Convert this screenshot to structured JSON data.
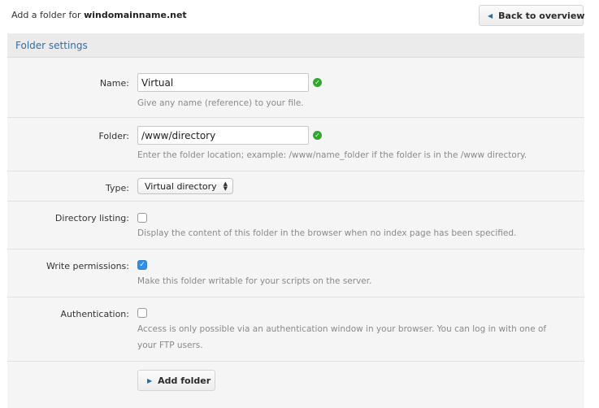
{
  "page": {
    "title_prefix": "Add a folder for",
    "domain": "windomainname.net",
    "back_label": "Back to overview"
  },
  "panel": {
    "title": "Folder settings"
  },
  "form": {
    "name": {
      "label": "Name:",
      "value": "Virtual",
      "help": "Give any name (reference) to your file."
    },
    "folder": {
      "label": "Folder:",
      "value": "/www/directory",
      "help": "Enter the folder location; example: /www/name_folder if the folder is in the /www directory."
    },
    "type": {
      "label": "Type:",
      "value": "Virtual directory"
    },
    "directory_listing": {
      "label": "Directory listing:",
      "checked": false,
      "help": "Display the content of this folder in the browser when no index page has been specified."
    },
    "write_permissions": {
      "label": "Write permissions:",
      "checked": true,
      "help": "Make this folder writable for your scripts on the server."
    },
    "authentication": {
      "label": "Authentication:",
      "checked": false,
      "help": "Access is only possible via an authentication window in your browser. You can log in with one of your FTP users."
    }
  },
  "submit_label": "Add folder",
  "icons": {
    "valid": "check-circle-icon",
    "back": "triangle-left-icon",
    "submit": "triangle-right-icon",
    "select_arrows": "updown-arrows-icon"
  },
  "colors": {
    "accent": "#2c6fb0",
    "valid": "#2ea82e",
    "checkbox_checked": "#2c8fe8",
    "panel_bg": "#f5f5f5"
  }
}
